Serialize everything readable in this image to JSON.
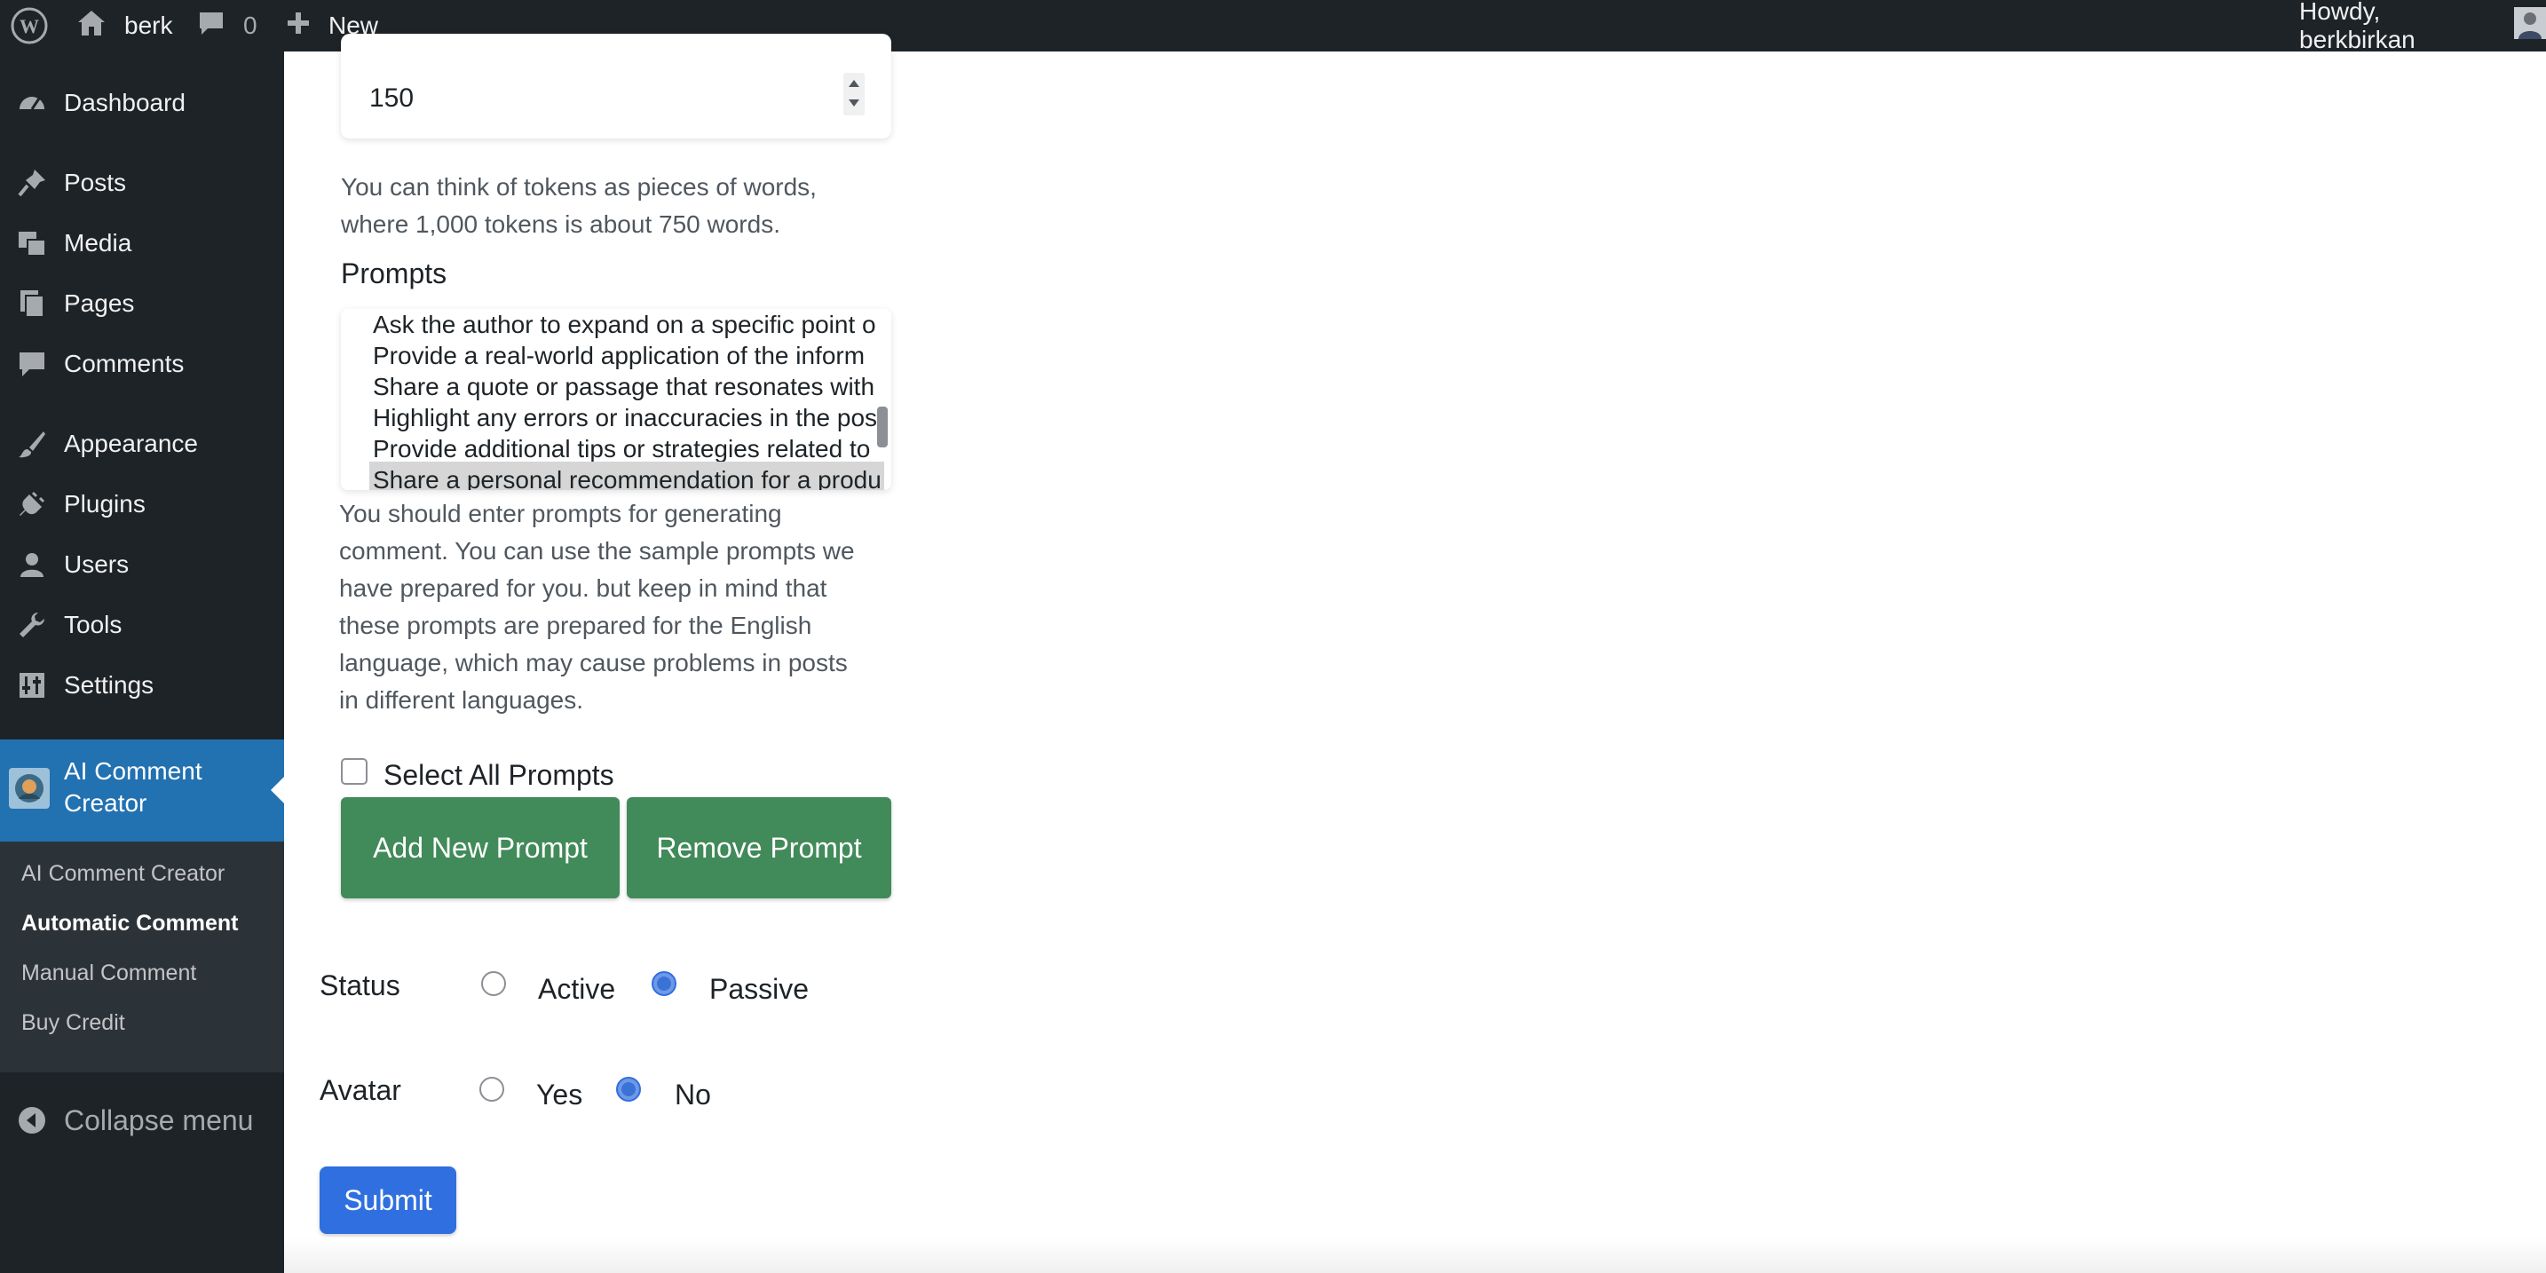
{
  "adminbar": {
    "site_name": "berk",
    "comment_count": "0",
    "new_label": "New",
    "howdy": "Howdy, berkbirkan"
  },
  "sidebar": {
    "items": [
      {
        "label": "Dashboard",
        "icon": "dashboard-icon"
      },
      {
        "label": "Posts",
        "icon": "pin-icon"
      },
      {
        "label": "Media",
        "icon": "media-icon"
      },
      {
        "label": "Pages",
        "icon": "pages-icon"
      },
      {
        "label": "Comments",
        "icon": "comment-icon"
      },
      {
        "label": "Appearance",
        "icon": "brush-icon"
      },
      {
        "label": "Plugins",
        "icon": "plug-icon"
      },
      {
        "label": "Users",
        "icon": "user-icon"
      },
      {
        "label": "Tools",
        "icon": "wrench-icon"
      },
      {
        "label": "Settings",
        "icon": "settings-icon"
      }
    ],
    "active_item": {
      "line1": "AI Comment",
      "line2": "Creator"
    },
    "submenu": [
      "AI Comment Creator",
      "Automatic Comment",
      "Manual Comment",
      "Buy Credit"
    ],
    "collapse_label": "Collapse menu"
  },
  "form": {
    "max_tokens_value": "150",
    "tokens_help_line1": "You can think of tokens as pieces of words,",
    "tokens_help_line2": "where 1,000 tokens is about 750 words.",
    "prompts_label": "Prompts",
    "prompts": [
      "Ask the author to expand on a specific point o",
      "Provide a real-world application of the inform",
      "Share a quote or passage that resonates with",
      "Highlight any errors or inaccuracies in the pos",
      "Provide additional tips or strategies related to",
      "Share a personal recommendation for a produ"
    ],
    "prompts_help": [
      "You should enter prompts for generating",
      "comment. You can use the sample prompts we",
      "have prepared for you. but keep in mind that",
      "these prompts are prepared for the English",
      "language, which may cause problems in posts",
      "in different languages."
    ],
    "select_all_label": "Select All Prompts",
    "add_prompt_label": "Add New Prompt",
    "remove_prompt_label": "Remove Prompt",
    "status_label": "Status",
    "status_options": [
      "Active",
      "Passive"
    ],
    "status_selected": "Passive",
    "avatar_label": "Avatar",
    "avatar_options": [
      "Yes",
      "No"
    ],
    "avatar_selected": "No",
    "submit_label": "Submit"
  },
  "colors": {
    "adminbar_bg": "#1d2327",
    "active_menu_bg": "#2271b1",
    "green_button": "#418a59",
    "submit_button": "#2f6fe0"
  }
}
